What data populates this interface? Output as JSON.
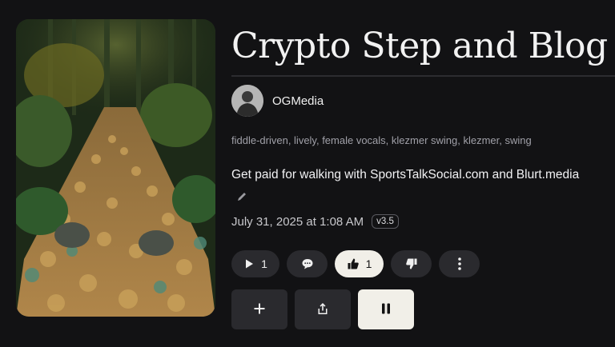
{
  "song": {
    "title": "Crypto Step and Blog",
    "author": "OGMedia",
    "tags": "fiddle-driven, lively, female vocals, klezmer swing, klezmer, swing",
    "description": "Get paid for walking with SportsTalkSocial.com and Blurt.media",
    "date": "July 31, 2025 at 1:08 AM",
    "version": "v3.5"
  },
  "actions": {
    "play_count": "1",
    "like_count": "1"
  },
  "colors": {
    "background": "#121214",
    "pill": "#2a2a2e",
    "active": "#f1efe8"
  },
  "icons": [
    "play-icon",
    "comment-icon",
    "thumbs-up-icon",
    "thumbs-down-icon",
    "more-icon",
    "plus-icon",
    "share-icon",
    "pause-icon",
    "pencil-icon"
  ]
}
